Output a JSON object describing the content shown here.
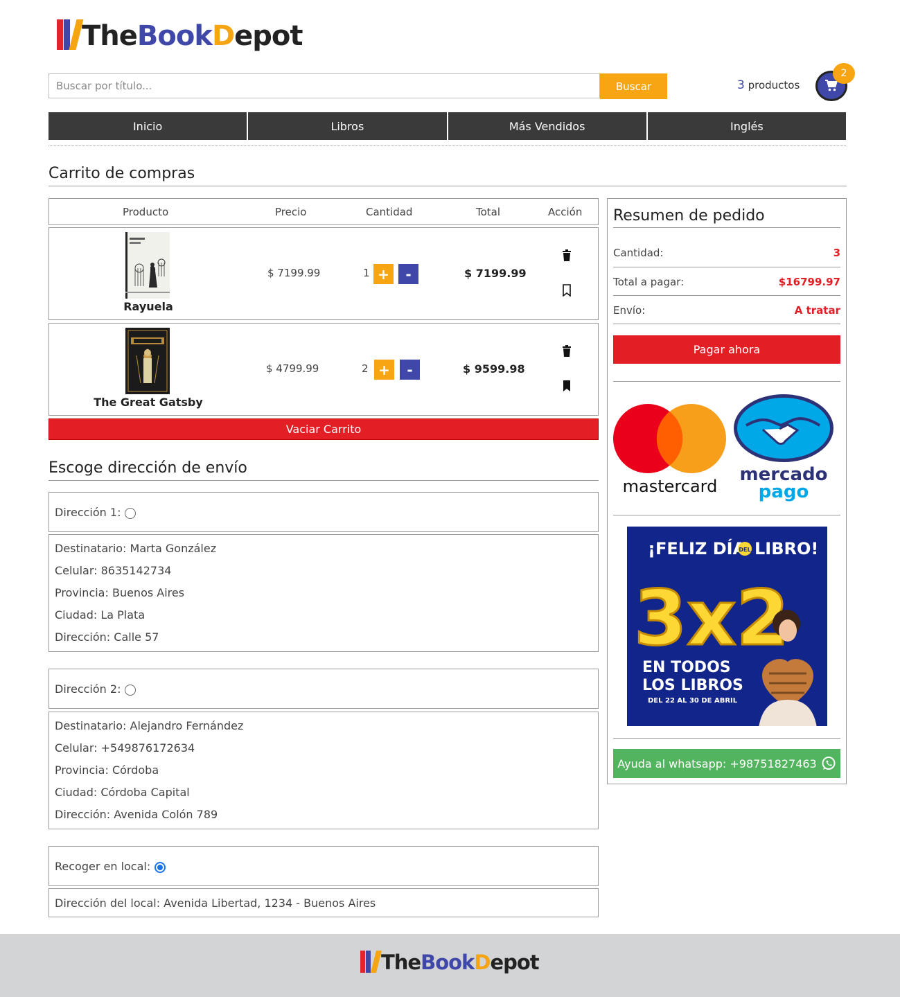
{
  "brand": {
    "part1": "The",
    "part2": "Book",
    "part3": "D",
    "part4": "epot"
  },
  "search": {
    "placeholder": "Buscar por título...",
    "button_label": "Buscar"
  },
  "cart": {
    "count_number": "3",
    "count_label": "productos",
    "badge": "2",
    "icon": "cart-icon"
  },
  "nav": {
    "items": [
      "Inicio",
      "Libros",
      "Más Vendidos",
      "Inglés"
    ]
  },
  "cart_section": {
    "title": "Carrito de compras",
    "headers": {
      "product": "Producto",
      "price": "Precio",
      "quantity": "Cantidad",
      "total": "Total",
      "action": "Acción"
    },
    "items": [
      {
        "title": "Rayuela",
        "price": "$ 7199.99",
        "qty": "1",
        "total": "$ 7199.99",
        "saved": false
      },
      {
        "title": "The Great Gatsby",
        "price": "$ 4799.99",
        "qty": "2",
        "total": "$ 9599.98",
        "saved": true
      }
    ],
    "plus_label": "+",
    "minus_label": "-",
    "empty_button": "Vaciar Carrito"
  },
  "shipping": {
    "title": "Escoge dirección de envío",
    "options": [
      {
        "label": "Dirección 1:",
        "selected": false,
        "lines": [
          "Destinatario: Marta González",
          "Celular: 8635142734",
          "Provincia: Buenos Aires",
          "Ciudad: La Plata",
          "Dirección: Calle 57"
        ]
      },
      {
        "label": "Dirección 2:",
        "selected": false,
        "lines": [
          "Destinatario: Alejandro Fernández",
          "Celular: +549876172634",
          "Provincia: Córdoba",
          "Ciudad: Córdoba Capital",
          "Dirección: Avenida Colón 789"
        ]
      }
    ],
    "pickup": {
      "label": "Recoger en local:",
      "selected": true,
      "address": "Dirección del local: Avenida Libertad, 1234 - Buenos Aires"
    }
  },
  "summary": {
    "title": "Resumen de pedido",
    "quantity_label": "Cantidad:",
    "quantity_value": "3",
    "total_label": "Total a pagar:",
    "total_value": "$16799.97",
    "shipping_label": "Envío:",
    "shipping_value": "A tratar",
    "pay_button": "Pagar ahora",
    "mastercard_label": "mastercard",
    "mercadopago_label1": "mercado",
    "mercadopago_label2": "pago",
    "promo": {
      "heading_part1": "¡FELIZ DÍA",
      "heading_small": "DEL",
      "heading_part2": "LIBRO!",
      "big": "3x2",
      "line1": "EN TODOS",
      "line2": "LOS LIBROS",
      "dates": "DEL 22 AL 30 DE ABRIL"
    },
    "whatsapp_button": "Ayuda al whatsapp: +98751827463"
  },
  "colors": {
    "accent_orange": "#f8a513",
    "brand_blue": "#3f48a8",
    "danger_red": "#e31e24",
    "nav_dark": "#3a3a3a",
    "whatsapp_green": "#52b45e"
  }
}
